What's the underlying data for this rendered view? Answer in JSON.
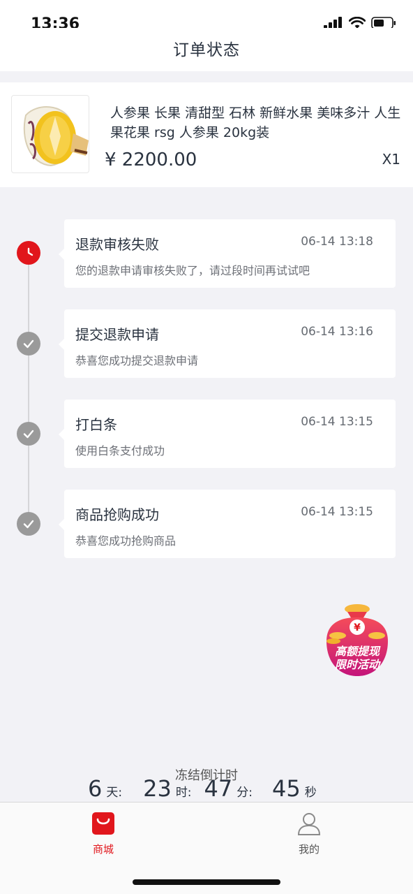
{
  "status_bar": {
    "time": "13:36"
  },
  "header": {
    "title": "订单状态"
  },
  "product": {
    "title": "人参果 长果 清甜型 石林 新鲜水果 美味多汁 人生果花果 rsg 人参果 20kg装",
    "price": "¥ 2200.00",
    "quantity": "X1"
  },
  "timeline": [
    {
      "title": "退款审核失败",
      "time": "06-14 13:18",
      "desc": "您的退款申请审核失败了，请过段时间再试试吧",
      "status": "failed"
    },
    {
      "title": "提交退款申请",
      "time": "06-14 13:16",
      "desc": "恭喜您成功提交退款申请",
      "status": "done"
    },
    {
      "title": "打白条",
      "time": "06-14 13:15",
      "desc": "使用白条支付成功",
      "status": "done"
    },
    {
      "title": "商品抢购成功",
      "time": "06-14 13:15",
      "desc": "恭喜您成功抢购商品",
      "status": "done"
    }
  ],
  "promo": {
    "currency_symbol": "¥",
    "line1": "高额提现",
    "line2": "限时活动"
  },
  "countdown": {
    "label": "冻结倒计时",
    "days": "6",
    "days_unit": "天:",
    "hours": "23",
    "hours_unit": "时:",
    "minutes": "47",
    "minutes_unit": "分:",
    "seconds": "45",
    "seconds_unit": "秒"
  },
  "tabs": [
    {
      "label": "商城",
      "icon": "shopping-bag-icon",
      "active": true
    },
    {
      "label": "我的",
      "icon": "user-icon",
      "active": false
    }
  ],
  "colors": {
    "accent": "#e1161c",
    "inactive_dot": "#9a9a9a",
    "background": "#f2f2f6"
  }
}
